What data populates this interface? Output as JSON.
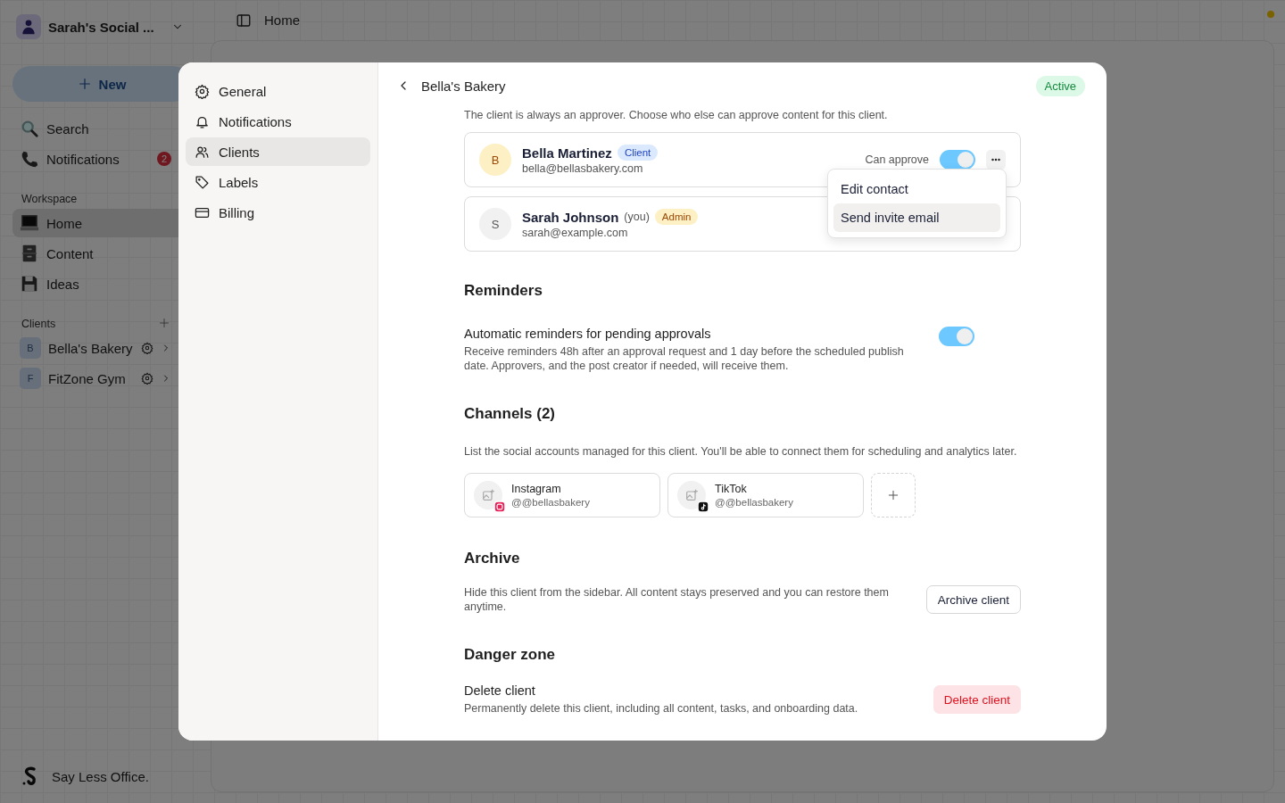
{
  "app": {
    "workspace": "Sarah's Social ...",
    "new_button": "New",
    "nav": [
      {
        "label": "Search",
        "kind": "search"
      },
      {
        "label": "Notifications",
        "kind": "phone",
        "badge": "2"
      }
    ],
    "workspace_heading": "Workspace",
    "workspace_items": [
      {
        "label": "Home",
        "kind": "laptop",
        "selected": true
      },
      {
        "label": "Content",
        "kind": "cabinet",
        "selected": false
      },
      {
        "label": "Ideas",
        "kind": "floppy",
        "selected": false
      }
    ],
    "clients_heading": "Clients",
    "clients": [
      {
        "initial": "B",
        "name": "Bella's Bakery"
      },
      {
        "initial": "F",
        "name": "FitZone Gym"
      }
    ],
    "footer": "Say Less Office.",
    "breadcrumb": "Home"
  },
  "dialog": {
    "nav": [
      {
        "label": "General",
        "kind": "gear",
        "selected": false
      },
      {
        "label": "Notifications",
        "kind": "bell",
        "selected": false
      },
      {
        "label": "Clients",
        "kind": "users",
        "selected": true
      },
      {
        "label": "Labels",
        "kind": "tag",
        "selected": false
      },
      {
        "label": "Billing",
        "kind": "card",
        "selected": false
      }
    ],
    "title": "Bella's Bakery",
    "status": "Active",
    "intro": "The client is always an approver. Choose who else can approve content for this client.",
    "approvers": [
      {
        "initial": "B",
        "name": "Bella Martinez",
        "role": "Client",
        "kind": "client",
        "email": "bella@bellasbakery.com",
        "approve_label": "Can approve",
        "can_approve": true
      },
      {
        "initial": "S",
        "name": "Sarah Johnson",
        "you": "(you)",
        "role": "Admin",
        "kind": "admin",
        "email": "sarah@example.com"
      }
    ],
    "menu": [
      {
        "label": "Edit contact",
        "selected": false
      },
      {
        "label": "Send invite email",
        "selected": true
      }
    ],
    "reminders": {
      "heading": "Reminders",
      "title": "Automatic reminders for pending approvals",
      "description": "Receive reminders 48h after an approval request and 1 day before the scheduled publish date. Approvers, and the post creator if needed, will receive them.",
      "on": true
    },
    "channels": {
      "heading": "Channels (2)",
      "description": "List the social accounts managed for this client. You'll be able to connect them for scheduling and analytics later.",
      "items": [
        {
          "name": "Instagram",
          "handle": "@@bellasbakery",
          "kind": "instagram"
        },
        {
          "name": "TikTok",
          "handle": "@@bellasbakery",
          "kind": "tiktok"
        }
      ]
    },
    "archive": {
      "heading": "Archive",
      "description": "Hide this client from the sidebar. All content stays preserved and you can restore them anytime.",
      "button": "Archive client"
    },
    "danger": {
      "heading": "Danger zone",
      "title": "Delete client",
      "description": "Permanently delete this client, including all content, tasks, and onboarding data.",
      "button": "Delete client"
    }
  }
}
